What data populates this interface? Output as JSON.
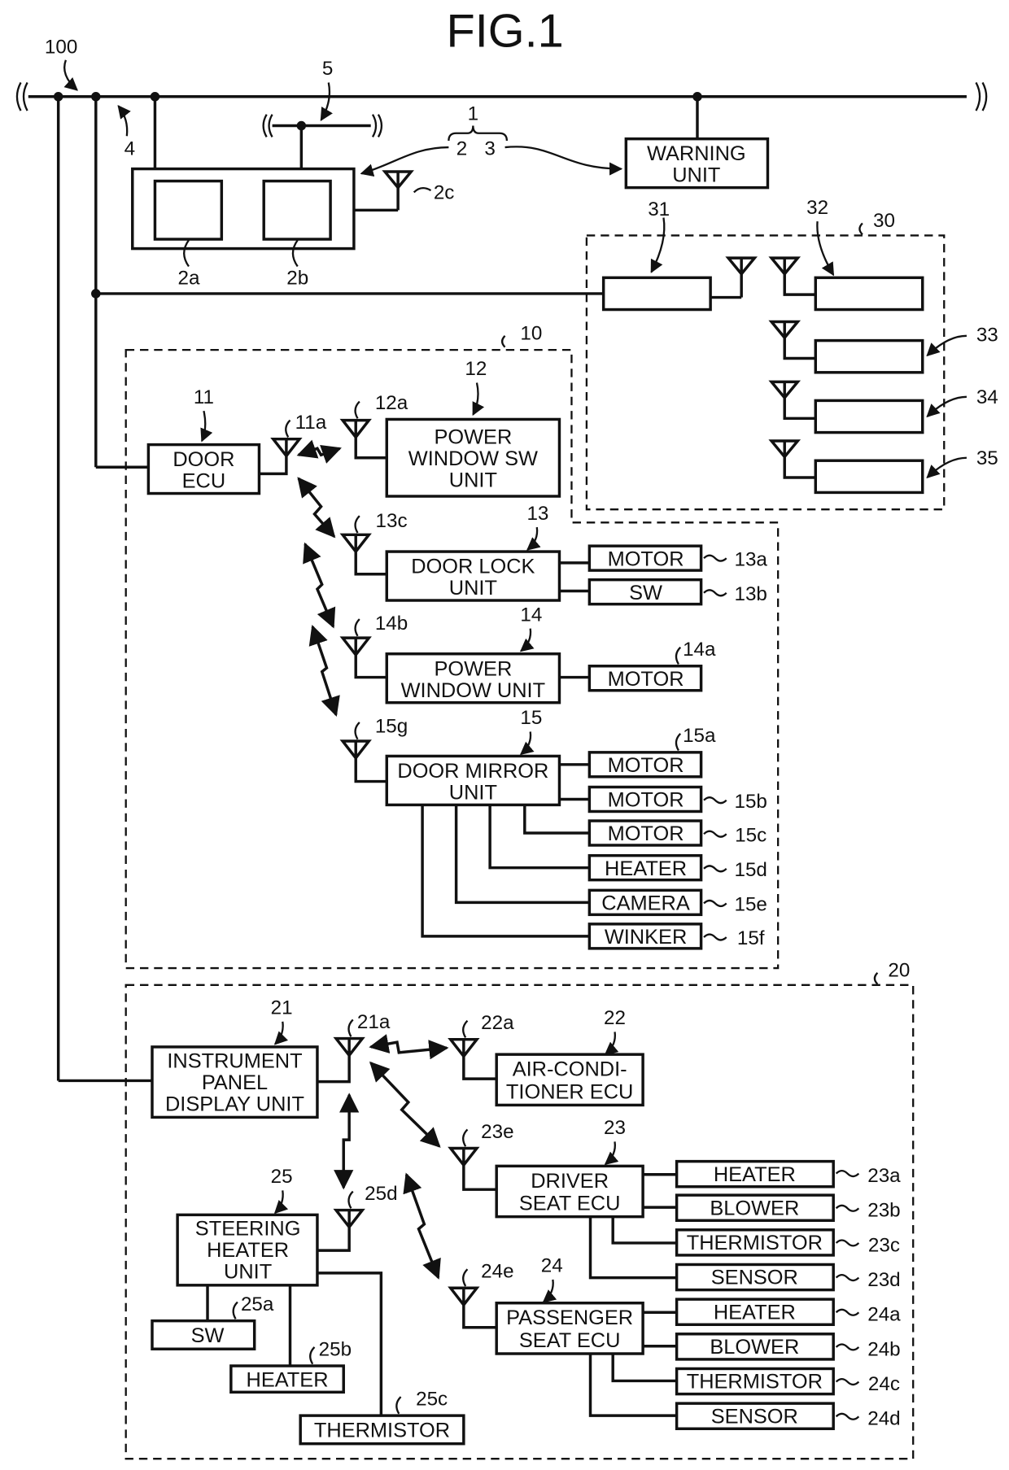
{
  "figure": {
    "title": "FIG.1",
    "ref_system": "100",
    "ref_bus": "4",
    "ref_bus2": "5",
    "ref_group": "1",
    "ref_group_sub": [
      "2",
      "3"
    ],
    "ref_2a": "2a",
    "ref_2b": "2b",
    "ref_2c": "2c"
  },
  "warning_unit": {
    "lines": [
      "WARNING",
      "UNIT"
    ]
  },
  "region30": {
    "ref": "30",
    "items": [
      {
        "ref": "31"
      },
      {
        "ref": "32"
      },
      {
        "ref": "33"
      },
      {
        "ref": "34"
      },
      {
        "ref": "35"
      }
    ]
  },
  "region10": {
    "ref": "10",
    "door_ecu": {
      "ref": "11",
      "antenna_ref": "11a",
      "lines": [
        "DOOR",
        "ECU"
      ]
    },
    "pw_sw_unit": {
      "ref": "12",
      "antenna_ref": "12a",
      "lines": [
        "POWER",
        "WINDOW SW",
        "UNIT"
      ]
    },
    "door_lock_unit": {
      "ref": "13",
      "antenna_ref": "13c",
      "lines": [
        "DOOR LOCK",
        "UNIT"
      ],
      "children": [
        {
          "label": "MOTOR",
          "ref": "13a"
        },
        {
          "label": "SW",
          "ref": "13b"
        }
      ]
    },
    "power_window_unit": {
      "ref": "14",
      "antenna_ref": "14b",
      "lines": [
        "POWER",
        "WINDOW UNIT"
      ],
      "children": [
        {
          "label": "MOTOR",
          "ref": "14a"
        }
      ]
    },
    "door_mirror_unit": {
      "ref": "15",
      "antenna_ref": "15g",
      "lines": [
        "DOOR MIRROR",
        "UNIT"
      ],
      "children": [
        {
          "label": "MOTOR",
          "ref": "15a"
        },
        {
          "label": "MOTOR",
          "ref": "15b"
        },
        {
          "label": "MOTOR",
          "ref": "15c"
        },
        {
          "label": "HEATER",
          "ref": "15d"
        },
        {
          "label": "CAMERA",
          "ref": "15e"
        },
        {
          "label": "WINKER",
          "ref": "15f"
        }
      ]
    }
  },
  "region20": {
    "ref": "20",
    "instrument_panel": {
      "ref": "21",
      "antenna_ref": "21a",
      "lines": [
        "INSTRUMENT",
        "PANEL",
        "DISPLAY UNIT"
      ]
    },
    "air_conditioner_ecu": {
      "ref": "22",
      "antenna_ref": "22a",
      "lines": [
        "AIR-CONDI-",
        "TIONER ECU"
      ]
    },
    "driver_seat_ecu": {
      "ref": "23",
      "antenna_ref": "23e",
      "lines": [
        "DRIVER",
        "SEAT ECU"
      ],
      "children": [
        {
          "label": "HEATER",
          "ref": "23a"
        },
        {
          "label": "BLOWER",
          "ref": "23b"
        },
        {
          "label": "THERMISTOR",
          "ref": "23c"
        },
        {
          "label": "SENSOR",
          "ref": "23d"
        }
      ]
    },
    "passenger_seat_ecu": {
      "ref": "24",
      "antenna_ref": "24e",
      "lines": [
        "PASSENGER",
        "SEAT ECU"
      ],
      "children": [
        {
          "label": "HEATER",
          "ref": "24a"
        },
        {
          "label": "BLOWER",
          "ref": "24b"
        },
        {
          "label": "THERMISTOR",
          "ref": "24c"
        },
        {
          "label": "SENSOR",
          "ref": "24d"
        }
      ]
    },
    "steering_heater_unit": {
      "ref": "25",
      "antenna_ref": "25d",
      "lines": [
        "STEERING",
        "HEATER",
        "UNIT"
      ],
      "children": [
        {
          "label": "SW",
          "ref": "25a"
        },
        {
          "label": "HEATER",
          "ref": "25b"
        },
        {
          "label": "THERMISTOR",
          "ref": "25c"
        }
      ]
    }
  }
}
